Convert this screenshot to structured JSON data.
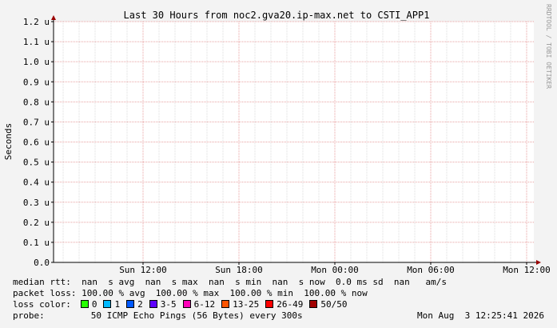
{
  "chart_data": {
    "type": "line",
    "title": "Last 30 Hours from noc2.gva20.ip-max.net to CSTI_APP1",
    "ylabel": "Seconds",
    "xlabel": "",
    "ylim": [
      0,
      1.2e-06
    ],
    "y_ticks": [
      "0.0",
      "0.1 u",
      "0.2 u",
      "0.3 u",
      "0.4 u",
      "0.5 u",
      "0.6 u",
      "0.7 u",
      "0.8 u",
      "0.9 u",
      "1.0 u",
      "1.1 u",
      "1.2 u"
    ],
    "x_ticks": [
      "Sun 12:00",
      "Sun 18:00",
      "Mon 00:00",
      "Mon 06:00",
      "Mon 12:00"
    ],
    "grid": true,
    "series": [],
    "watermark": "RRDTOOL / TOBI OETIKER"
  },
  "legend": {
    "median_rtt": "median rtt:  nan  s avg  nan  s max  nan  s min  nan  s now  0.0 ms sd  nan   am/s",
    "packet_loss": "packet loss: 100.00 % avg  100.00 % max  100.00 % min  100.00 % now",
    "loss_color_label": "loss color:",
    "loss_colors": [
      {
        "label": "0",
        "color": "#26ff00"
      },
      {
        "label": "1",
        "color": "#00b8ff"
      },
      {
        "label": "2",
        "color": "#0059ff"
      },
      {
        "label": "3-5",
        "color": "#5e00ff"
      },
      {
        "label": "6-12",
        "color": "#ff00b8"
      },
      {
        "label": "13-25",
        "color": "#ff5500"
      },
      {
        "label": "26-49",
        "color": "#ff0000"
      },
      {
        "label": "50/50",
        "color": "#a10000"
      }
    ],
    "probe_label": "probe:",
    "probe_text": "50 ICMP Echo Pings (56 Bytes) every 300s",
    "timestamp": "Mon Aug  3 12:25:41 2026"
  },
  "colors": {
    "background": "#f3f3f3",
    "plot_bg": "#ffffff",
    "minor_grid": "#dddddd",
    "major_grid": "#e8a0a0",
    "axis": "#000000",
    "arrow": "#990000"
  }
}
